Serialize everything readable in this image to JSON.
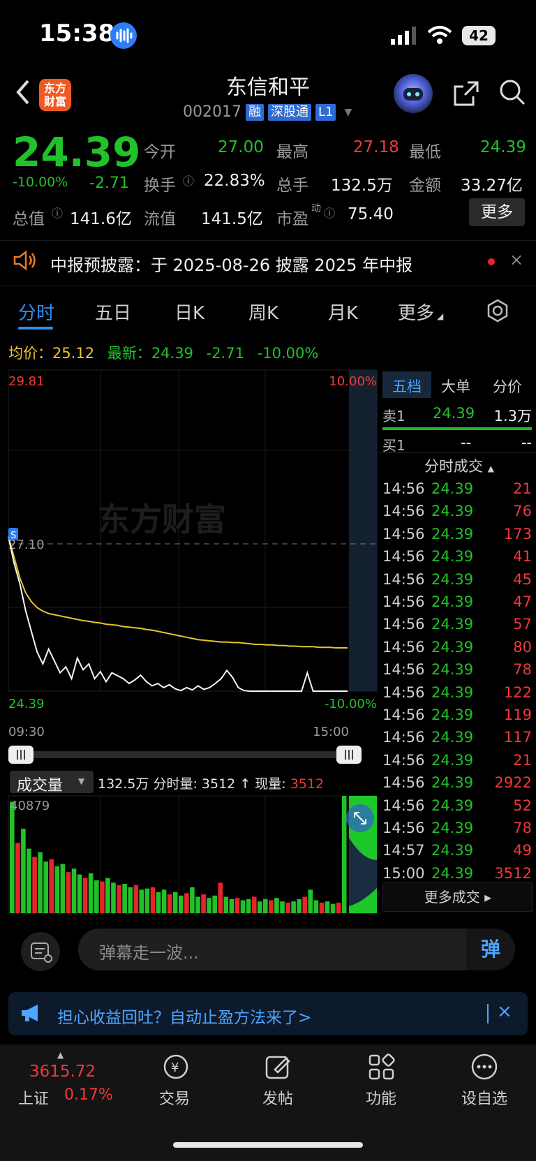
{
  "status_bar": {
    "time": "15:38",
    "battery": "42"
  },
  "header": {
    "brand_logo": "东方\n财富",
    "stock_name": "东信和平",
    "code": "002017",
    "tags": [
      "融",
      "深股通",
      "L1"
    ]
  },
  "quote": {
    "price": "24.39",
    "change_pct": "-10.00%",
    "change": "-2.71",
    "rows": [
      [
        {
          "label": "今开",
          "value": "27.00",
          "color": "green"
        },
        {
          "label": "最高",
          "value": "27.18",
          "color": "red"
        },
        {
          "label": "最低",
          "value": "24.39",
          "color": "green"
        }
      ],
      [
        {
          "label": "换手",
          "value": "22.83%",
          "color": "white"
        },
        {
          "label": "总手",
          "value": "132.5万",
          "color": "white"
        },
        {
          "label": "金额",
          "value": "33.27亿",
          "color": "white"
        }
      ],
      [
        {
          "label": "总值",
          "value": "141.6亿",
          "color": "white"
        },
        {
          "label": "流值",
          "value": "141.5亿",
          "color": "white"
        },
        {
          "label": "市盈",
          "value": "75.40",
          "color": "white"
        }
      ]
    ],
    "pe_superscript": "动",
    "more_label": "更多"
  },
  "notice": {
    "text": "中报预披露：于 2025-08-26 披露 2025 年中报",
    "close": "×"
  },
  "tabs": [
    "分时",
    "五日",
    "日K",
    "周K",
    "月K",
    "更多"
  ],
  "chart_info": {
    "avg_label": "均价：",
    "avg": "25.12",
    "latest_label": "最新：",
    "latest": "24.39",
    "change": "-2.71",
    "change_pct": "-10.00%"
  },
  "chart_labels": {
    "y_top": "29.81",
    "y_top_pct": "10.00%",
    "y_prev_close": "27.10",
    "y_bottom": "24.39",
    "y_bottom_pct": "-10.00%",
    "x_start": "09:30",
    "x_end": "15:00",
    "watermark": "东方财富",
    "volume_max": "40879"
  },
  "chart_data": {
    "type": "line",
    "x_range": [
      "09:30",
      "15:00"
    ],
    "ylim": [
      24.39,
      29.81
    ],
    "prev_close": 27.1,
    "series": [
      {
        "values": [
          27.0,
          26.55,
          26.2,
          25.75,
          25.4,
          25.05,
          24.85,
          25.1,
          24.9,
          24.7,
          24.8,
          24.6,
          24.95,
          24.75,
          24.85,
          24.6,
          24.72,
          24.55,
          24.7,
          24.65,
          24.6,
          24.52,
          24.58,
          24.66,
          24.55,
          24.48,
          24.52,
          24.45,
          24.5,
          24.43,
          24.4,
          24.45,
          24.41,
          24.48,
          24.42,
          24.45,
          24.52,
          24.6,
          24.74,
          24.62,
          24.45,
          24.4,
          24.39,
          24.39,
          24.39,
          24.39,
          24.39,
          24.39,
          24.39,
          24.39,
          24.39,
          24.39,
          24.7,
          24.39,
          24.39,
          24.39,
          24.39,
          24.39,
          24.39,
          24.39
        ]
      },
      {
        "values": [
          27.0,
          26.65,
          26.3,
          26.05,
          25.9,
          25.8,
          25.74,
          25.7,
          25.68,
          25.66,
          25.64,
          25.62,
          25.6,
          25.58,
          25.57,
          25.55,
          25.54,
          25.52,
          25.51,
          25.5,
          25.48,
          25.47,
          25.46,
          25.45,
          25.43,
          25.42,
          25.4,
          25.38,
          25.36,
          25.34,
          25.32,
          25.3,
          25.28,
          25.26,
          25.25,
          25.24,
          25.23,
          25.22,
          25.22,
          25.21,
          25.21,
          25.2,
          25.19,
          25.18,
          25.18,
          25.17,
          25.17,
          25.16,
          25.16,
          25.15,
          25.15,
          25.14,
          25.14,
          25.14,
          25.13,
          25.13,
          25.13,
          25.12,
          25.12,
          25.12
        ]
      }
    ],
    "volume": [
      95,
      60,
      72,
      55,
      48,
      52,
      44,
      46,
      40,
      42,
      35,
      38,
      33,
      30,
      34,
      28,
      27,
      30,
      26,
      24,
      25,
      22,
      24,
      20,
      21,
      22,
      18,
      20,
      16,
      18,
      15,
      17,
      22,
      14,
      16,
      13,
      15,
      26,
      14,
      12,
      13,
      11,
      12,
      14,
      10,
      12,
      11,
      13,
      10,
      9,
      10,
      12,
      14,
      20,
      11,
      9,
      10,
      8,
      9,
      100
    ]
  },
  "volume_bar": {
    "label": "成交量",
    "total": "132.5万",
    "period_label": "分时量:",
    "period": "3512",
    "current_label": "现量:",
    "current": "3512"
  },
  "right_panel": {
    "tabs": [
      "五档",
      "大单",
      "分价"
    ],
    "sell1": {
      "label": "卖1",
      "price": "24.39",
      "vol": "1.3万"
    },
    "buy1": {
      "label": "买1",
      "price": "--",
      "vol": "--"
    },
    "trades_header": "分时成交",
    "trades": [
      {
        "time": "14:56",
        "price": "24.39",
        "vol": "21"
      },
      {
        "time": "14:56",
        "price": "24.39",
        "vol": "76"
      },
      {
        "time": "14:56",
        "price": "24.39",
        "vol": "173"
      },
      {
        "time": "14:56",
        "price": "24.39",
        "vol": "41"
      },
      {
        "time": "14:56",
        "price": "24.39",
        "vol": "45"
      },
      {
        "time": "14:56",
        "price": "24.39",
        "vol": "47"
      },
      {
        "time": "14:56",
        "price": "24.39",
        "vol": "57"
      },
      {
        "time": "14:56",
        "price": "24.39",
        "vol": "80"
      },
      {
        "time": "14:56",
        "price": "24.39",
        "vol": "78"
      },
      {
        "time": "14:56",
        "price": "24.39",
        "vol": "122"
      },
      {
        "time": "14:56",
        "price": "24.39",
        "vol": "119"
      },
      {
        "time": "14:56",
        "price": "24.39",
        "vol": "117"
      },
      {
        "time": "14:56",
        "price": "24.39",
        "vol": "21"
      },
      {
        "time": "14:56",
        "price": "24.39",
        "vol": "2922"
      },
      {
        "time": "14:56",
        "price": "24.39",
        "vol": "52"
      },
      {
        "time": "14:56",
        "price": "24.39",
        "vol": "78"
      },
      {
        "time": "14:57",
        "price": "24.39",
        "vol": "49"
      },
      {
        "time": "15:00",
        "price": "24.39",
        "vol": "3512"
      }
    ],
    "more_trades": "更多成交 ▸"
  },
  "comment": {
    "placeholder": "弹幕走一波...",
    "send_label": "弹"
  },
  "promo": {
    "text": "担心收益回吐？自动止盈方法来了>",
    "close": "×"
  },
  "bottom_nav": {
    "index_value": "3615.72",
    "index_name": "上证",
    "index_change": "0.17%",
    "items": [
      "交易",
      "发帖",
      "功能",
      "设自选"
    ]
  }
}
